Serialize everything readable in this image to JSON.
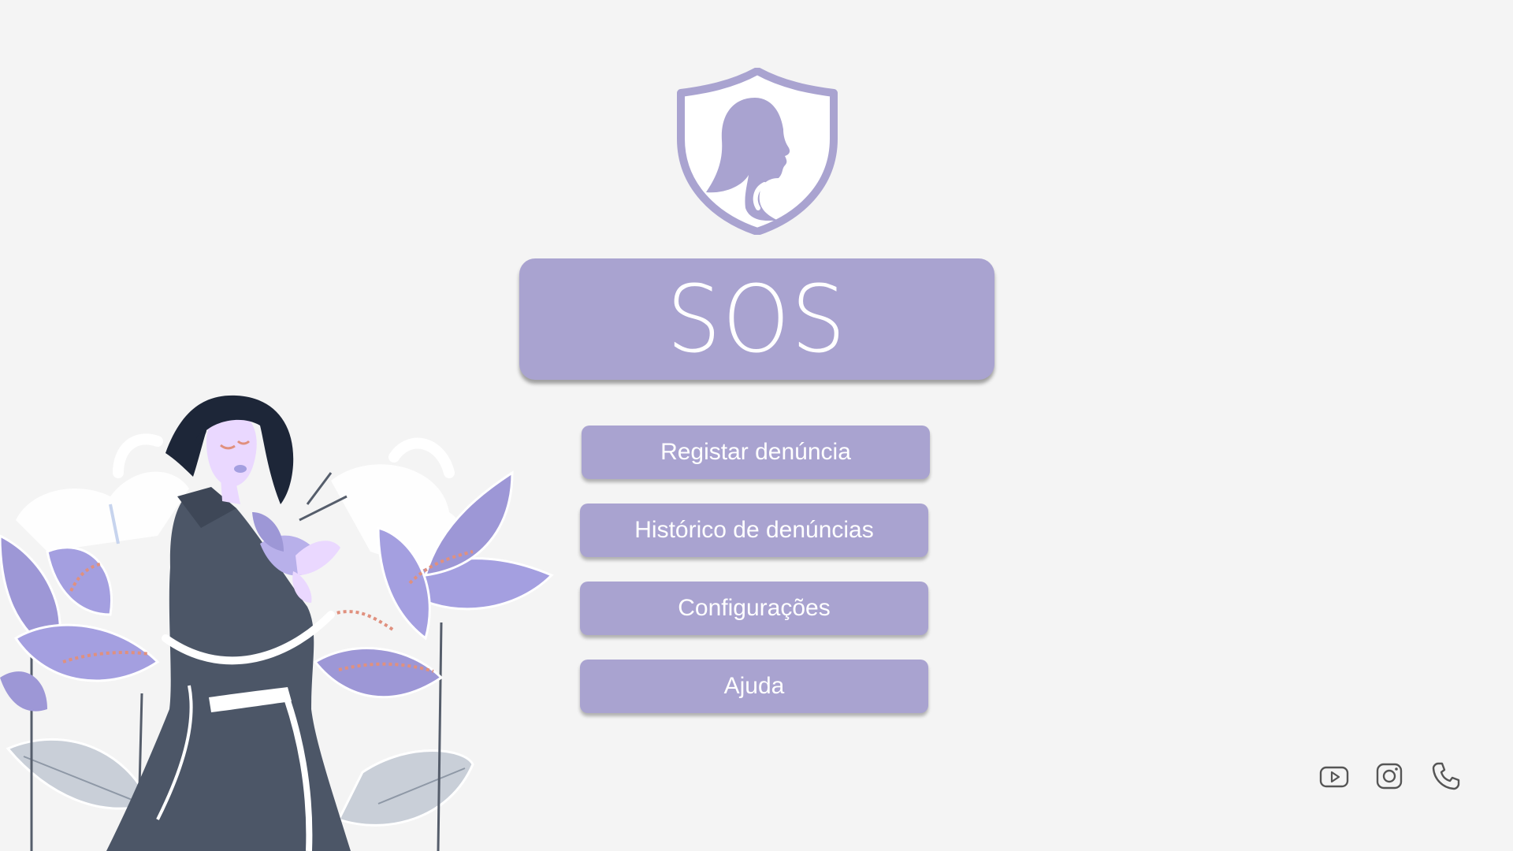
{
  "app": {
    "banner_title": "SOS"
  },
  "menu": {
    "items": [
      {
        "label": "Registar denúncia"
      },
      {
        "label": "Histórico de denúncias"
      },
      {
        "label": "Configurações"
      },
      {
        "label": "Ajuda"
      }
    ]
  },
  "social": {
    "icons": [
      "youtube-icon",
      "instagram-icon",
      "phone-icon"
    ]
  },
  "colors": {
    "accent": "#a9a3d0",
    "background": "#f4f4f4",
    "text_on_accent": "#ffffff",
    "icon_stroke": "#555555"
  }
}
